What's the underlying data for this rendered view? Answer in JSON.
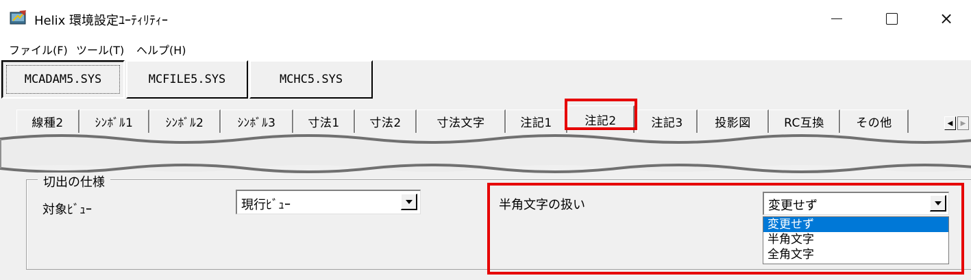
{
  "window": {
    "title": "Helix 環境設定ﾕｰﾃｨﾘﾃｨｰ",
    "icon": "app-icon",
    "controls": {
      "minimize": "minimize-icon",
      "maximize": "maximize-icon",
      "close": "×"
    }
  },
  "menu": [
    "ファイル(F)",
    "ツール(T)",
    "ヘルプ(H)"
  ],
  "file_tabs": [
    "MCADAM5.SYS",
    "MCFILE5.SYS",
    "MCHC5.SYS"
  ],
  "sub_tabs": [
    "線種2",
    "ｼﾝﾎﾞﾙ1",
    "ｼﾝﾎﾞﾙ2",
    "ｼﾝﾎﾞﾙ3",
    "寸法1",
    "寸法2",
    "寸法文字",
    "注記1",
    "注記2",
    "注記3",
    "投影図",
    "RC互換",
    "その他"
  ],
  "tab_scroll": {
    "left": "◀",
    "right": "▶"
  },
  "group": {
    "title": "切出の仕様",
    "view_label": "対象ﾋﾞｭｰ",
    "view_value": "現行ﾋﾞｭｰ",
    "halfwidth_label": "半角文字の扱い",
    "halfwidth_value": "変更せず",
    "halfwidth_options": [
      "変更せず",
      "半角文字",
      "全角文字"
    ]
  },
  "colors": {
    "highlight": "#e60000",
    "selection": "#0078d7"
  }
}
